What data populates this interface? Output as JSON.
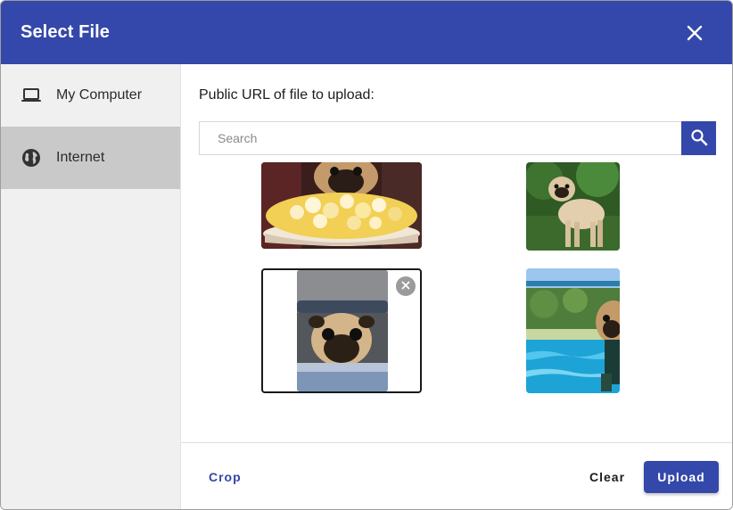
{
  "dialog": {
    "title": "Select File",
    "close_icon": "close-icon"
  },
  "sidebar": {
    "items": [
      {
        "label": "My Computer",
        "icon": "laptop-icon",
        "active": false
      },
      {
        "label": "Internet",
        "icon": "globe-icon",
        "active": true
      }
    ]
  },
  "main": {
    "url_label": "Public URL of file to upload:",
    "search": {
      "placeholder": "Search",
      "value": "",
      "icon": "search-icon"
    },
    "images": [
      {
        "subject": "pug with popcorn",
        "selected": false
      },
      {
        "subject": "pug standing on grass",
        "selected": false
      },
      {
        "subject": "pug looking out of car window",
        "selected": true
      },
      {
        "subject": "pug by swimming pool",
        "selected": false
      }
    ]
  },
  "footer": {
    "crop_label": "Crop",
    "clear_label": "Clear",
    "upload_label": "Upload"
  },
  "colors": {
    "primary": "#3447aa",
    "sidebar_bg": "#f0f0f0",
    "sidebar_active": "#c9c9c9"
  }
}
